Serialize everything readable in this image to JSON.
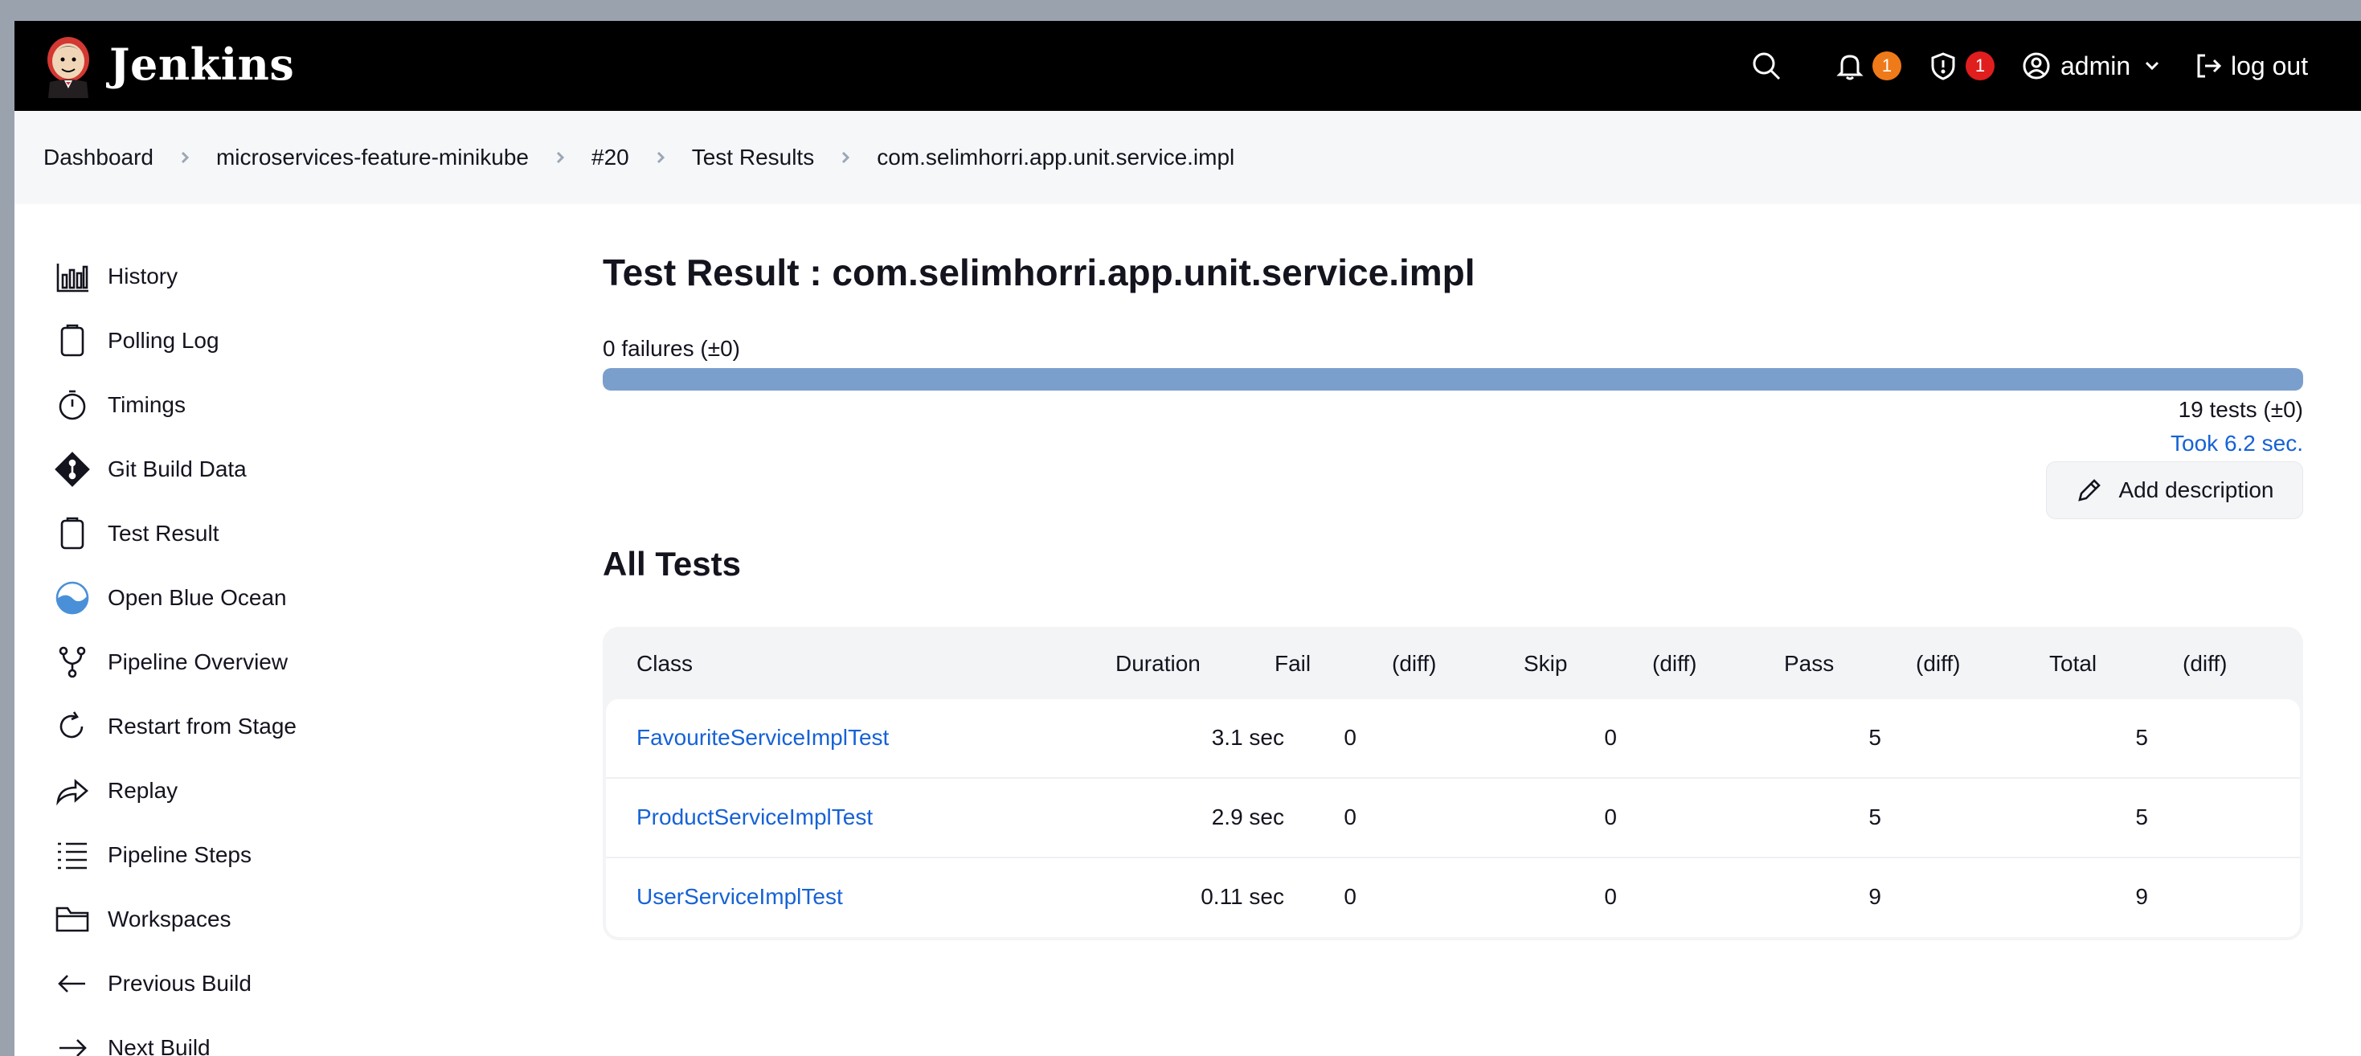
{
  "header": {
    "brand": "Jenkins",
    "notifications_count": "1",
    "security_count": "1",
    "user": "admin",
    "logout": "log out",
    "colors": {
      "notif_badge": "#ef7a1a",
      "security_badge": "#e01e1e"
    }
  },
  "breadcrumb": [
    "Dashboard",
    "microservices-feature-minikube",
    "#20",
    "Test Results",
    "com.selimhorri.app.unit.service.impl"
  ],
  "sidebar": {
    "items": [
      {
        "label": "History",
        "icon": "bar-chart-icon"
      },
      {
        "label": "Polling Log",
        "icon": "clipboard-icon"
      },
      {
        "label": "Timings",
        "icon": "stopwatch-icon"
      },
      {
        "label": "Git Build Data",
        "icon": "git-icon"
      },
      {
        "label": "Test Result",
        "icon": "clipboard-icon"
      },
      {
        "label": "Open Blue Ocean",
        "icon": "blue-ocean-icon"
      },
      {
        "label": "Pipeline Overview",
        "icon": "branch-icon"
      },
      {
        "label": "Restart from Stage",
        "icon": "restart-icon"
      },
      {
        "label": "Replay",
        "icon": "replay-icon"
      },
      {
        "label": "Pipeline Steps",
        "icon": "list-icon"
      },
      {
        "label": "Workspaces",
        "icon": "folder-icon"
      },
      {
        "label": "Previous Build",
        "icon": "arrow-left-icon"
      },
      {
        "label": "Next Build",
        "icon": "arrow-right-icon"
      }
    ]
  },
  "main": {
    "title": "Test Result : com.selimhorri.app.unit.service.impl",
    "failures": "0 failures (±0)",
    "pass_ratio": 1.0,
    "tests": "19 tests (±0)",
    "took": "Took 6.2 sec.",
    "add_description": "Add description",
    "all_tests_title": "All Tests",
    "table": {
      "headers": [
        "Class",
        "Duration",
        "Fail",
        "(diff)",
        "Skip",
        "(diff)",
        "Pass",
        "(diff)",
        "Total",
        "(diff)"
      ],
      "rows": [
        {
          "class": "FavouriteServiceImplTest",
          "duration": "3.1 sec",
          "fail": "0",
          "skip": "0",
          "pass": "5",
          "total": "5"
        },
        {
          "class": "ProductServiceImplTest",
          "duration": "2.9 sec",
          "fail": "0",
          "skip": "0",
          "pass": "5",
          "total": "5"
        },
        {
          "class": "UserServiceImplTest",
          "duration": "0.11 sec",
          "fail": "0",
          "skip": "0",
          "pass": "9",
          "total": "9"
        }
      ]
    }
  }
}
